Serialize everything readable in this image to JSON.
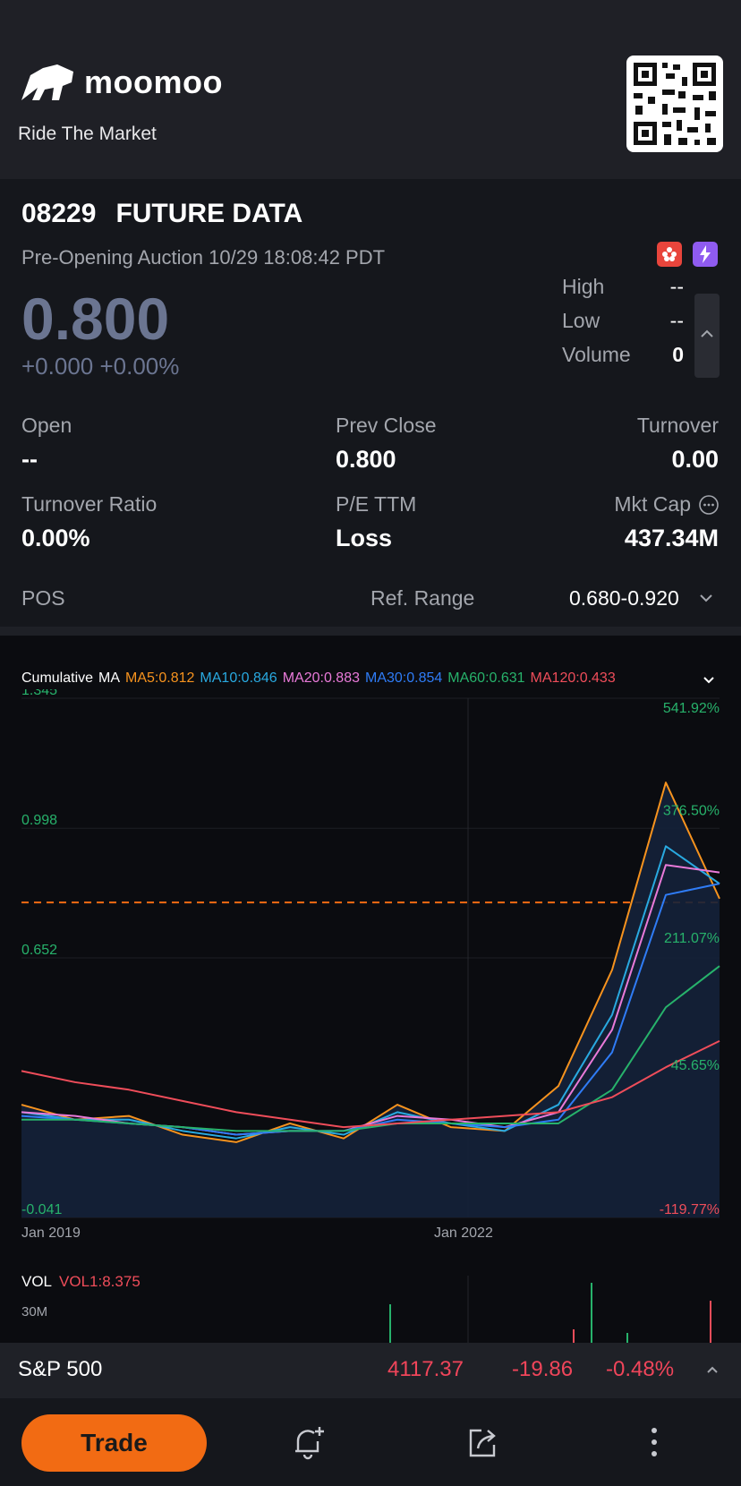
{
  "banner": {
    "brand": "moomoo",
    "tagline": "Ride The Market"
  },
  "quote": {
    "code": "08229",
    "name": "FUTURE DATA",
    "status": "Pre-Opening Auction 10/29 18:08:42 PDT",
    "price": "0.800",
    "change": "+0.000 +0.00%",
    "high_label": "High",
    "high_value": "--",
    "low_label": "Low",
    "low_value": "--",
    "volume_label": "Volume",
    "volume_value": "0"
  },
  "stats": {
    "open_label": "Open",
    "open_value": "--",
    "prev_close_label": "Prev Close",
    "prev_close_value": "0.800",
    "turnover_label": "Turnover",
    "turnover_value": "0.00",
    "turnover_ratio_label": "Turnover Ratio",
    "turnover_ratio_value": "0.00%",
    "pe_label": "P/E TTM",
    "pe_value": "Loss",
    "mkt_cap_label": "Mkt Cap",
    "mkt_cap_value": "437.34M",
    "pos_label": "POS",
    "ref_range_label": "Ref. Range",
    "ref_range_value": "0.680-0.920"
  },
  "chart": {
    "mode": "Cumulative",
    "ma_label": "MA",
    "ma": [
      {
        "label": "MA5:0.812",
        "color": "#f7931e"
      },
      {
        "label": "MA10:0.846",
        "color": "#29a9e0"
      },
      {
        "label": "MA20:0.883",
        "color": "#e97ad9"
      },
      {
        "label": "MA30:0.854",
        "color": "#2f7cf6"
      },
      {
        "label": "MA60:0.631",
        "color": "#27b26b"
      },
      {
        "label": "MA120:0.433",
        "color": "#ef4d5a"
      }
    ],
    "y_left": [
      "1.345",
      "0.998",
      "0.652",
      "-0.041"
    ],
    "y_right": [
      "541.92%",
      "376.50%",
      "211.07%",
      "45.65%",
      "-119.77%"
    ],
    "x_labels": [
      "Jan 2019",
      "Jan 2022"
    ],
    "vol_label": "VOL",
    "vol_value": "VOL1:8.375",
    "vol_axis": "30M"
  },
  "chart_data": {
    "type": "line",
    "xlabel": "",
    "ylabel": "",
    "ylim": [
      -0.041,
      1.345
    ],
    "x": [
      "Jan 2019",
      "",
      "",
      "",
      "",
      "",
      "",
      "Jan 2022",
      "",
      "",
      "",
      "",
      "",
      ""
    ],
    "series": [
      {
        "name": "MA5",
        "color": "#f7931e",
        "values": [
          0.26,
          0.22,
          0.23,
          0.18,
          0.16,
          0.21,
          0.17,
          0.26,
          0.2,
          0.19,
          0.31,
          0.62,
          1.12,
          0.81
        ]
      },
      {
        "name": "MA10",
        "color": "#29a9e0",
        "values": [
          0.24,
          0.22,
          0.22,
          0.19,
          0.17,
          0.2,
          0.18,
          0.24,
          0.21,
          0.19,
          0.26,
          0.5,
          0.95,
          0.85
        ]
      },
      {
        "name": "MA20",
        "color": "#e97ad9",
        "values": [
          0.24,
          0.23,
          0.21,
          0.2,
          0.18,
          0.19,
          0.19,
          0.23,
          0.22,
          0.2,
          0.24,
          0.46,
          0.9,
          0.88
        ]
      },
      {
        "name": "MA30",
        "color": "#2f7cf6",
        "values": [
          0.23,
          0.22,
          0.21,
          0.2,
          0.18,
          0.19,
          0.19,
          0.22,
          0.21,
          0.2,
          0.22,
          0.4,
          0.82,
          0.85
        ]
      },
      {
        "name": "MA60",
        "color": "#27b26b",
        "values": [
          0.22,
          0.22,
          0.21,
          0.2,
          0.19,
          0.19,
          0.19,
          0.21,
          0.21,
          0.21,
          0.21,
          0.3,
          0.52,
          0.63
        ]
      },
      {
        "name": "MA120",
        "color": "#ef4d5a",
        "values": [
          0.35,
          0.32,
          0.3,
          0.27,
          0.24,
          0.22,
          0.2,
          0.21,
          0.22,
          0.23,
          0.24,
          0.28,
          0.36,
          0.43
        ]
      }
    ]
  },
  "index_bar": {
    "name": "S&P 500",
    "value": "4117.37",
    "change": "-19.86",
    "change_pct": "-0.48%"
  },
  "bottom": {
    "trade_label": "Trade"
  }
}
